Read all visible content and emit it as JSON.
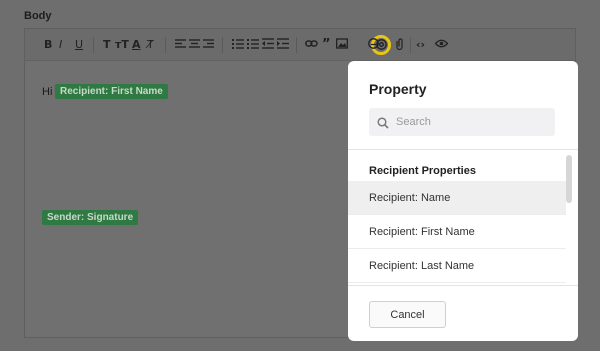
{
  "field_label": "Body",
  "toolbar": {
    "items": [
      {
        "name": "bold-button",
        "glyph": "B"
      },
      {
        "name": "italic-button",
        "glyph": "I"
      },
      {
        "name": "underline-button",
        "glyph": "U"
      },
      {
        "name": "text-format-button",
        "glyph": "T"
      },
      {
        "name": "font-size-button",
        "glyph": "тT"
      },
      {
        "name": "text-color-button",
        "glyph": "A"
      },
      {
        "name": "clear-format-button",
        "glyph": "T̸"
      }
    ],
    "highlighted_color": "#e9c516"
  },
  "editor": {
    "greeting": "Hi",
    "recipient_chip": "Recipient: First Name",
    "sender_chip": "Sender: Signature",
    "chip_color": "#2f7a42"
  },
  "modal": {
    "title": "Property",
    "search_placeholder": "Search",
    "section_header": "Recipient Properties",
    "items": [
      {
        "label": "Recipient: Name",
        "active": true
      },
      {
        "label": "Recipient: First Name",
        "active": false
      },
      {
        "label": "Recipient: Last Name",
        "active": false
      }
    ],
    "cancel_label": "Cancel"
  }
}
